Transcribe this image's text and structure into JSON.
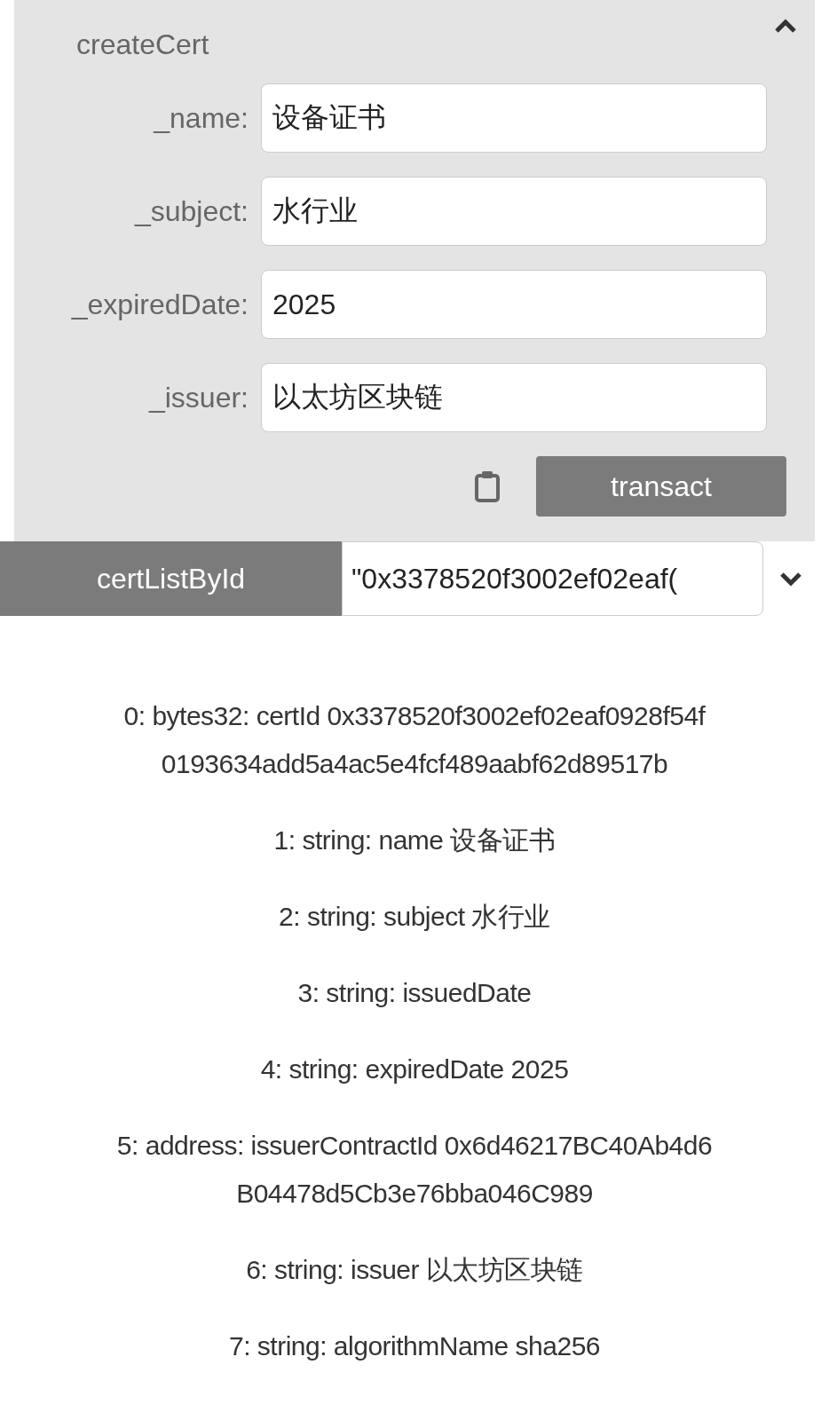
{
  "create_panel": {
    "title": "createCert",
    "expanded": true,
    "fields": [
      {
        "label": "_name:",
        "value": "设备证书"
      },
      {
        "label": "_subject:",
        "value": "水行业"
      },
      {
        "label": "_expiredDate:",
        "value": "2025"
      },
      {
        "label": "_issuer:",
        "value": "以太坊区块链"
      }
    ],
    "button": "transact"
  },
  "call": {
    "button": "certListById",
    "value": "\"0x3378520f3002ef02eaf(",
    "expanded": false
  },
  "results": [
    {
      "lines": [
        "0: bytes32: certId 0x3378520f3002ef02eaf0928f54f",
        "0193634add5a4ac5e4fcf489aabf62d89517b"
      ]
    },
    {
      "lines": [
        "1: string: name 设备证书"
      ]
    },
    {
      "lines": [
        "2: string: subject 水行业"
      ]
    },
    {
      "lines": [
        "3: string: issuedDate"
      ]
    },
    {
      "lines": [
        "4: string: expiredDate 2025"
      ]
    },
    {
      "lines": [
        "5: address: issuerContractId 0x6d46217BC40Ab4d6",
        "B04478d5Cb3e76bba046C989"
      ]
    },
    {
      "lines": [
        "6: string: issuer 以太坊区块链"
      ]
    },
    {
      "lines": [
        "7: string: algorithmName sha256"
      ]
    }
  ]
}
